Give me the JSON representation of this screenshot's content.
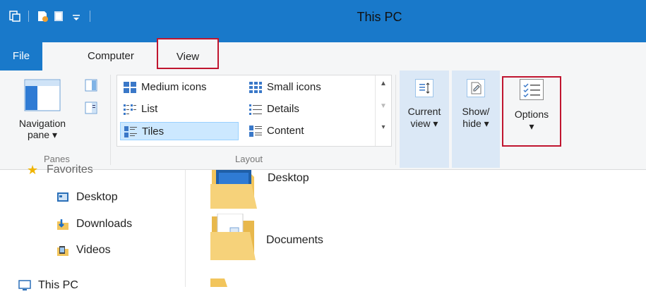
{
  "window": {
    "title": "This PC"
  },
  "tabs": {
    "file": "File",
    "computer": "Computer",
    "view": "View"
  },
  "ribbon": {
    "panes": {
      "navigation_pane_line1": "Navigation",
      "navigation_pane_line2": "pane",
      "group_label": "Panes"
    },
    "layout": {
      "items": [
        "Medium icons",
        "Small icons",
        "List",
        "Details",
        "Tiles",
        "Content"
      ],
      "selected": "Tiles",
      "group_label": "Layout"
    },
    "current_view": {
      "line1": "Current",
      "line2": "view"
    },
    "show_hide": {
      "line1": "Show/",
      "line2": "hide"
    },
    "options": {
      "label": "Options"
    }
  },
  "nav": {
    "favorites": "Favorites",
    "items": [
      "Desktop",
      "Downloads",
      "Videos"
    ],
    "this_pc": "This PC"
  },
  "content": {
    "folders": [
      "Desktop",
      "Documents"
    ]
  },
  "colors": {
    "titlebar": "#1979ca",
    "highlight": "#c0152f",
    "selected": "#cce8ff"
  }
}
